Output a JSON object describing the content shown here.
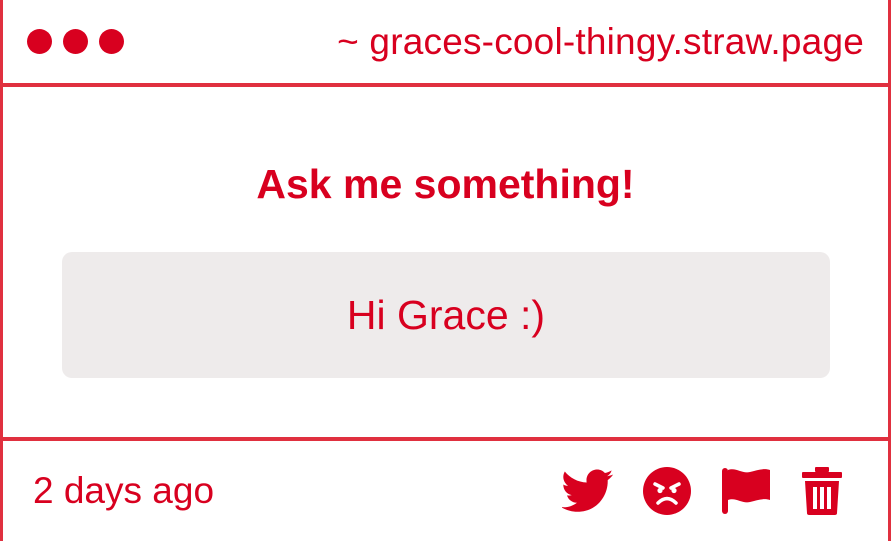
{
  "window": {
    "url": "~ graces-cool-thingy.straw.page"
  },
  "question": {
    "prompt": "Ask me something!",
    "answer": "Hi Grace :)"
  },
  "footer": {
    "timestamp": "2 days ago",
    "actions": [
      "twitter-icon",
      "angry-face-icon",
      "flag-icon",
      "trash-icon"
    ]
  },
  "colors": {
    "accent": "#d8001f",
    "border": "#e0303f",
    "box_bg": "#eeebeb",
    "background": "#ffffff"
  }
}
